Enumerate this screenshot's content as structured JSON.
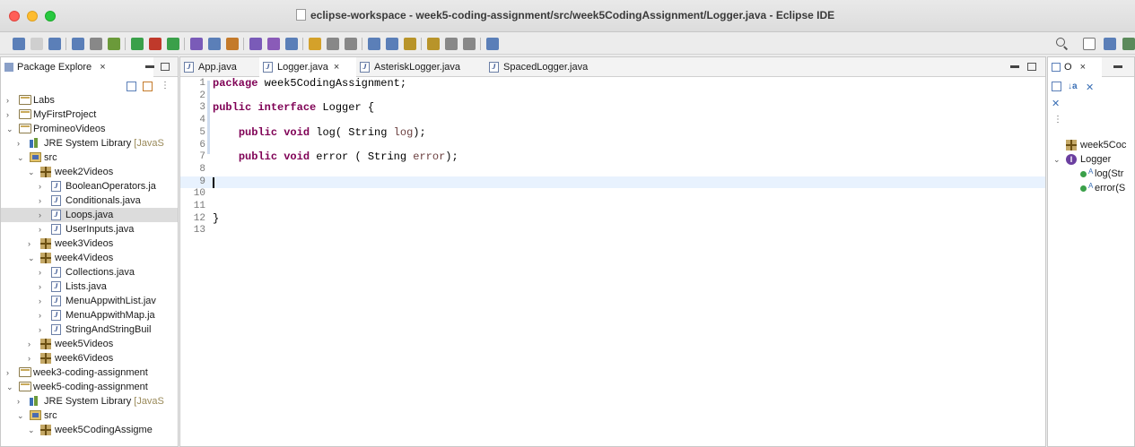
{
  "window": {
    "title": "eclipse-workspace - week5-coding-assignment/src/week5CodingAssignment/Logger.java - Eclipse IDE"
  },
  "package_explorer": {
    "tab_label": "Package Explore",
    "close_glyph": "×",
    "items": [
      {
        "label": "Labs",
        "icon": "project-icon",
        "expanded": false
      },
      {
        "label": "MyFirstProject",
        "icon": "project-icon",
        "expanded": false
      },
      {
        "label": "PromineoVideos",
        "icon": "project-icon",
        "expanded": true
      },
      {
        "label": "JRE System Library",
        "decor": "[JavaS",
        "icon": "library-icon",
        "expanded": false
      },
      {
        "label": "src",
        "icon": "source-folder-icon",
        "expanded": true
      },
      {
        "label": "week2Videos",
        "icon": "package-icon",
        "expanded": true
      },
      {
        "label": "BooleanOperators.ja",
        "icon": "java-file-icon",
        "expanded": false
      },
      {
        "label": "Conditionals.java",
        "icon": "java-file-icon",
        "expanded": false
      },
      {
        "label": "Loops.java",
        "icon": "java-file-icon",
        "expanded": false,
        "selected": true
      },
      {
        "label": "UserInputs.java",
        "icon": "java-file-icon",
        "expanded": false
      },
      {
        "label": "week3Videos",
        "icon": "package-icon",
        "expanded": false
      },
      {
        "label": "week4Videos",
        "icon": "package-icon",
        "expanded": true
      },
      {
        "label": "Collections.java",
        "icon": "java-file-icon",
        "expanded": false
      },
      {
        "label": "Lists.java",
        "icon": "java-file-icon",
        "expanded": false
      },
      {
        "label": "MenuAppwithList.jav",
        "icon": "java-file-icon",
        "expanded": false
      },
      {
        "label": "MenuAppwithMap.ja",
        "icon": "java-file-icon",
        "expanded": false
      },
      {
        "label": "StringAndStringBuil",
        "icon": "java-file-icon",
        "expanded": false
      },
      {
        "label": "week5Videos",
        "icon": "package-icon",
        "expanded": false
      },
      {
        "label": "week6Videos",
        "icon": "package-icon",
        "expanded": false
      },
      {
        "label": "week3-coding-assignment",
        "icon": "project-icon",
        "expanded": false
      },
      {
        "label": "week5-coding-assignment",
        "icon": "project-icon",
        "expanded": true
      },
      {
        "label": "JRE System Library",
        "decor": "[JavaS",
        "icon": "library-icon",
        "expanded": false
      },
      {
        "label": "src",
        "icon": "source-folder-icon",
        "expanded": true
      },
      {
        "label": "week5CodingAssigme",
        "icon": "package-icon",
        "expanded": true
      }
    ]
  },
  "editor": {
    "tabs": [
      {
        "label": "App.java",
        "active": false
      },
      {
        "label": "Logger.java",
        "active": true,
        "close": "×"
      },
      {
        "label": "AsteriskLogger.java",
        "active": false
      },
      {
        "label": "SpacedLogger.java",
        "active": false
      }
    ],
    "lines": [
      {
        "n": "1",
        "tokens": [
          {
            "t": "kw",
            "v": "package"
          },
          {
            "t": "p",
            "v": " week5CodingAssignment;"
          }
        ]
      },
      {
        "n": "2",
        "tokens": []
      },
      {
        "n": "3",
        "tokens": [
          {
            "t": "kw",
            "v": "public"
          },
          {
            "t": "p",
            "v": " "
          },
          {
            "t": "kw",
            "v": "interface"
          },
          {
            "t": "p",
            "v": " Logger {"
          }
        ]
      },
      {
        "n": "4",
        "tokens": []
      },
      {
        "n": "5",
        "tokens": [
          {
            "t": "p",
            "v": "    "
          },
          {
            "t": "kw",
            "v": "public"
          },
          {
            "t": "p",
            "v": " "
          },
          {
            "t": "kw",
            "v": "void"
          },
          {
            "t": "p",
            "v": " log( String "
          },
          {
            "t": "id",
            "v": "log"
          },
          {
            "t": "p",
            "v": ");"
          }
        ]
      },
      {
        "n": "6",
        "tokens": []
      },
      {
        "n": "7",
        "tokens": [
          {
            "t": "p",
            "v": "    "
          },
          {
            "t": "kw",
            "v": "public"
          },
          {
            "t": "p",
            "v": " "
          },
          {
            "t": "kw",
            "v": "void"
          },
          {
            "t": "p",
            "v": " error ( String "
          },
          {
            "t": "id",
            "v": "error"
          },
          {
            "t": "p",
            "v": ");"
          }
        ]
      },
      {
        "n": "8",
        "tokens": []
      },
      {
        "n": "9",
        "tokens": [],
        "current": true
      },
      {
        "n": "10",
        "tokens": []
      },
      {
        "n": "11",
        "tokens": []
      },
      {
        "n": "12",
        "tokens": [
          {
            "t": "p",
            "v": "}"
          }
        ]
      },
      {
        "n": "13",
        "tokens": []
      }
    ]
  },
  "outline": {
    "tab_label": "O",
    "close_glyph": "×",
    "items": [
      {
        "label": "week5Coc",
        "icon": "package-icon"
      },
      {
        "label": "Logger",
        "icon": "interface-icon"
      },
      {
        "label": "log(Str",
        "icon": "method-icon",
        "modifier": "A"
      },
      {
        "label": "error(S",
        "icon": "method-icon",
        "modifier": "A"
      }
    ]
  },
  "colors": {
    "keyword": "#7f0055",
    "current_line": "#e8f2fe",
    "selection": "#dcdcdc"
  }
}
